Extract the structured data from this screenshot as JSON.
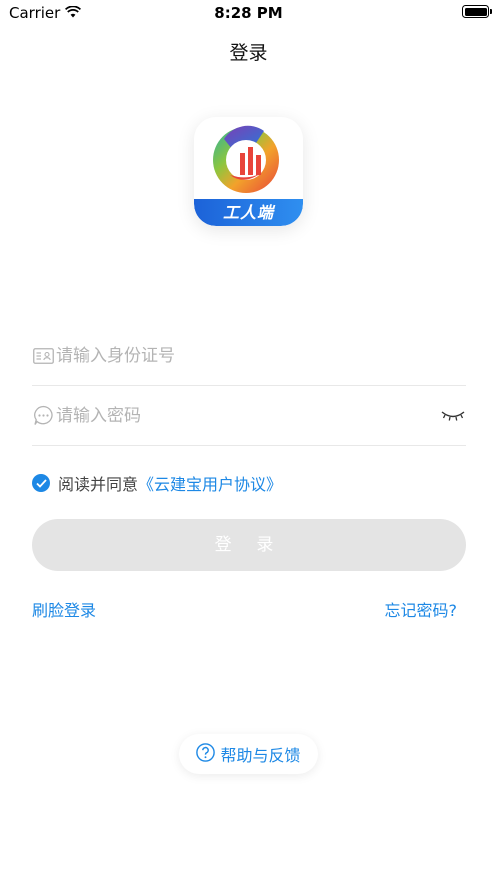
{
  "status_bar": {
    "carrier": "Carrier",
    "time": "8:28 PM"
  },
  "nav": {
    "title": "登录"
  },
  "logo": {
    "name": "工人端"
  },
  "form": {
    "id_placeholder": "请输入身份证号",
    "password_placeholder": "请输入密码"
  },
  "agreement": {
    "text": "阅读并同意",
    "link": "《云建宝用户协议》",
    "checked": true
  },
  "login_button": {
    "label": "登 录"
  },
  "links": {
    "face_login": "刷脸登录",
    "forgot_password": "忘记密码?"
  },
  "help": {
    "label": "帮助与反馈"
  },
  "colors": {
    "accent": "#1d88e5",
    "button_disabled": "#e4e4e4",
    "placeholder": "#b4b4b4"
  },
  "icons": [
    "wifi-icon",
    "battery-icon",
    "id-card-icon",
    "chat-bubble-icon",
    "eye-closed-icon",
    "check-icon",
    "question-icon"
  ]
}
